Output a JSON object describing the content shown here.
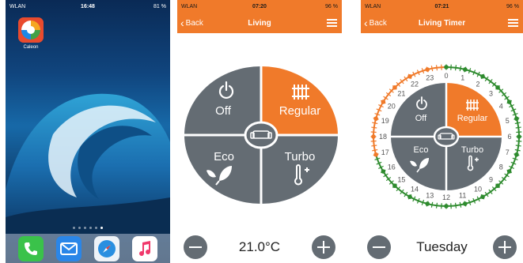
{
  "phone1": {
    "status": {
      "carrier": "WLAN",
      "time": "16:48",
      "battery": "81 %"
    },
    "app_label": "Caleon",
    "page_dots": 6,
    "dock": [
      "phone-icon",
      "mail-icon",
      "safari-icon",
      "music-icon"
    ]
  },
  "phone2": {
    "status": {
      "carrier": "WLAN",
      "time": "07:20",
      "battery": "96 %"
    },
    "back_label": "Back",
    "title": "Living",
    "modes": {
      "off": "Off",
      "regular": "Regular",
      "eco": "Eco",
      "turbo": "Turbo"
    },
    "selected_mode": "Regular",
    "temperature": "21.0°C",
    "colors": {
      "accent": "#f07a2a",
      "slate": "#646c73"
    }
  },
  "phone3": {
    "status": {
      "carrier": "WLAN",
      "time": "07:21",
      "battery": "96 %"
    },
    "back_label": "Back",
    "title": "Living Timer",
    "modes": {
      "off": "Off",
      "regular": "Regular",
      "eco": "Eco",
      "turbo": "Turbo"
    },
    "hours": [
      "0",
      "1",
      "2",
      "3",
      "4",
      "5",
      "6",
      "7",
      "8",
      "9",
      "10",
      "11",
      "12",
      "13",
      "14",
      "15",
      "16",
      "17",
      "18",
      "19",
      "20",
      "21",
      "22",
      "23"
    ],
    "day": "Tuesday",
    "colors": {
      "orange_segment": "#f07a2a",
      "green_segment": "#2e8b2e"
    }
  }
}
